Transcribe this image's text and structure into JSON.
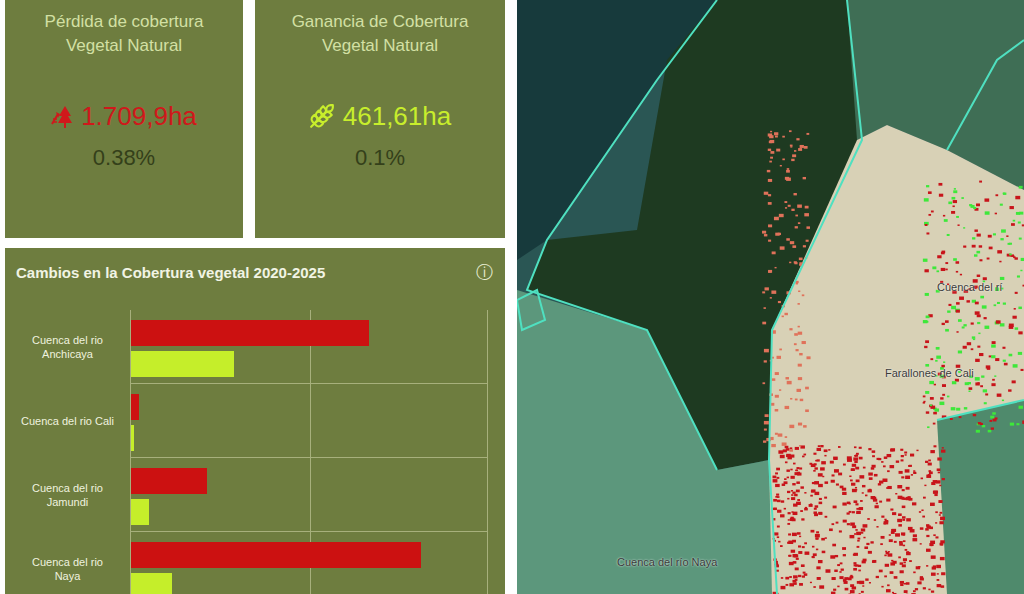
{
  "cards": [
    {
      "title": "Pérdida de cobertura Vegetal Natural",
      "value": "1.709,9ha",
      "percent": "0.38%",
      "color": "#d0181b"
    },
    {
      "title": "Ganancia de Cobertura Vegetal Natural",
      "value": "461,61ha",
      "percent": "0.1%",
      "color": "#c8ee2c"
    }
  ],
  "chart": {
    "title": "Cambios en la Cobertura vegetal 2020-2025",
    "info_icon": "ⓘ",
    "axis_max": 1000,
    "gridlines": [
      500
    ],
    "categories": [
      "Cuenca del rio Anchicaya",
      "Cuenca del rio Cali",
      "Cuenca del rio Jamundi",
      "Cuenca del rio Naya"
    ],
    "series": [
      {
        "color": "#cc1111",
        "values": [
          664,
          23,
          212,
          811
        ]
      },
      {
        "color": "#c5ee2a",
        "values": [
          288,
          8,
          51,
          115
        ]
      }
    ]
  },
  "map": {
    "labels": [
      {
        "text": "Cuenca del rí"
      },
      {
        "text": "Farallones de Cali"
      },
      {
        "text": "Cuenca del río Naya"
      }
    ]
  }
}
